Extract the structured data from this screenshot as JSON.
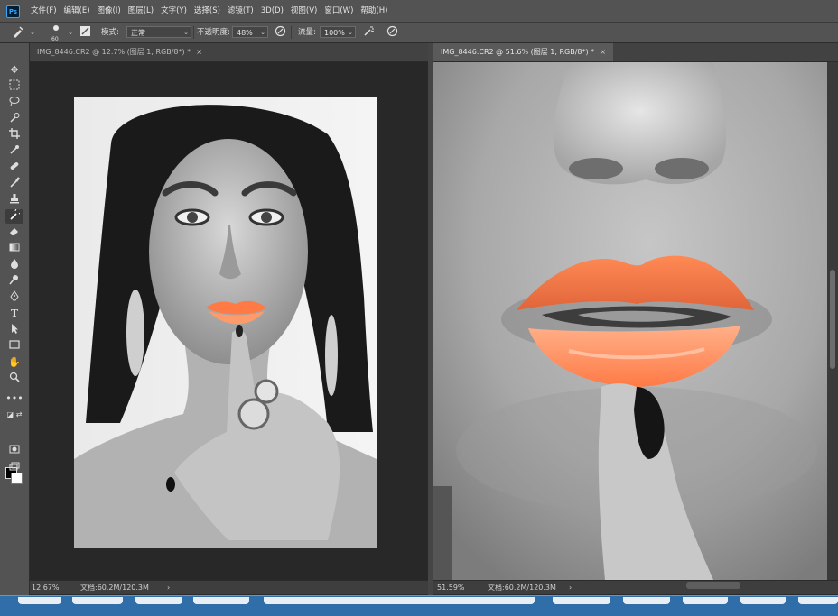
{
  "app": {
    "logo": "Ps"
  },
  "menubar": {
    "items": [
      "文件(F)",
      "编辑(E)",
      "图像(I)",
      "图层(L)",
      "文字(Y)",
      "选择(S)",
      "滤镜(T)",
      "3D(D)",
      "视图(V)",
      "窗口(W)",
      "帮助(H)"
    ]
  },
  "options": {
    "brush_size": "60",
    "mode_label": "模式:",
    "mode_value": "正常",
    "opacity_label": "不透明度:",
    "opacity_value": "48%",
    "flow_label": "流量:",
    "flow_value": "100%"
  },
  "documents": [
    {
      "tab_title": "IMG_8446.CR2 @ 12.7% (图层 1, RGB/8*) *",
      "close": "×",
      "zoom": "12.67%",
      "doc_info": "文档:60.2M/120.3M",
      "arrow": "›",
      "active": false
    },
    {
      "tab_title": "IMG_8446.CR2 @ 51.6% (图层 1, RGB/8*) *",
      "close": "×",
      "zoom": "51.59%",
      "doc_info": "文档:60.2M/120.3M",
      "arrow": "›",
      "active": true
    }
  ],
  "toolbar": {
    "tools": [
      "move-tool",
      "marquee-tool",
      "lasso-tool",
      "quick-select-tool",
      "crop-tool",
      "eyedropper-tool",
      "healing-brush-tool",
      "brush-tool",
      "clone-stamp-tool",
      "history-brush-tool",
      "eraser-tool",
      "gradient-tool",
      "blur-tool",
      "dodge-tool",
      "pen-tool",
      "type-tool",
      "path-select-tool",
      "rectangle-tool",
      "hand-tool",
      "zoom-tool",
      "more-tools"
    ],
    "foreground_color": "#000000",
    "background_color": "#ffffff"
  },
  "colors": {
    "lip_color": "#ff7a45",
    "accent_blue": "#31a8ff"
  }
}
